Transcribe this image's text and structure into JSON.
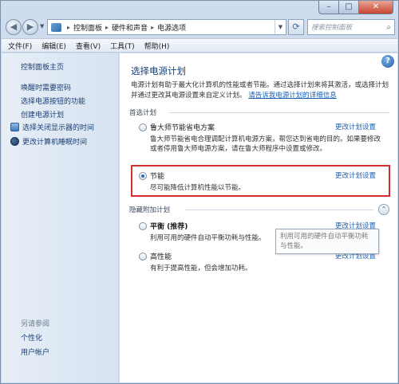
{
  "window": {
    "controls": {
      "minimize": "–",
      "maximize": "□",
      "close": "✕"
    }
  },
  "navbar": {
    "back_glyph": "◀",
    "forward_glyph": "▶",
    "breadcrumb": [
      "控制面板",
      "硬件和声音",
      "电源选项"
    ],
    "separator": "▸",
    "refresh_glyph": "⟳",
    "search_placeholder": "搜索控制面板"
  },
  "menubar": {
    "items": [
      "文件(F)",
      "编辑(E)",
      "查看(V)",
      "工具(T)",
      "帮助(H)"
    ]
  },
  "sidebar": {
    "home": "控制面板主页",
    "links": [
      "唤醒时需要密码",
      "选择电源按钮的功能",
      "创建电源计划"
    ],
    "icon_links": [
      {
        "label": "选择关闭显示器的时间",
        "icon": "monitor-icon"
      },
      {
        "label": "更改计算机睡眠时间",
        "icon": "moon-icon"
      }
    ],
    "see_also_title": "另请参阅",
    "see_also": [
      "个性化",
      "用户帐户"
    ]
  },
  "main": {
    "help_glyph": "?",
    "title": "选择电源计划",
    "description": "电源计划有助于最大化计算机的性能或者节能。通过选择计划来将其激活，或选择计划并通过更改其电源设置来自定义计划。",
    "description_link": "请告诉我电源计划的详细信息",
    "preferred_label": "首选计划",
    "hidden_label": "隐藏附加计划",
    "collapse_glyph": "⌃",
    "change_settings_label": "更改计划设置",
    "plans": [
      {
        "name": "鲁大师节能省电方案",
        "selected": false,
        "description": "鲁大师节能省电合理调配计算机电源方案，帮您达到省电的目的。如果要修改或者停用鲁大师电源方案，请在鲁大师程序中设置或修改。"
      },
      {
        "name": "节能",
        "selected": true,
        "description": "尽可能降低计算机性能以节能。"
      },
      {
        "name": "平衡 (推荐)",
        "selected": false,
        "description": "利用可用的硬件自动平衡功耗与性能。"
      },
      {
        "name": "高性能",
        "selected": false,
        "description": "有利于提高性能，但会增加功耗。"
      }
    ],
    "tooltip": "利用可用的硬件自动平衡功耗与性能。"
  }
}
